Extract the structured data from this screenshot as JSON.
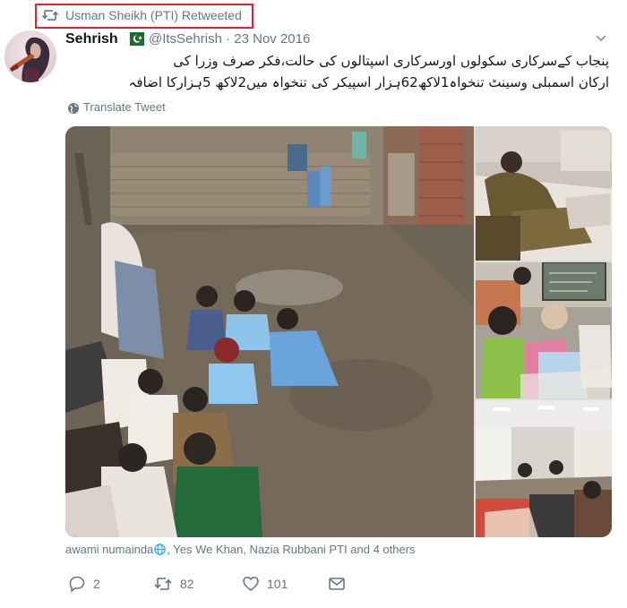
{
  "retweet_header": {
    "text": "Usman Sheikh (PTI) Retweeted",
    "icon": "retweet-icon",
    "highlight_color": "#e0242f"
  },
  "tweet": {
    "author_name": "Sehrish",
    "flag_icon": "pakistan-flag-icon",
    "handle": "@ItsSehrish",
    "date": "23 Nov 2016",
    "separator": "·",
    "body_line_1": "پنجاب کےسرکاری سکولوں اورسرکاری اسپتالوں کی حالت،فکر صرف وزرا کی",
    "body_line_2": "ارکان اسمبلی وسینٹ تنخواہ1لاکھ62ہزار اسپیکر کی تنخواہ میں2لاکھ 5ہزارکا اضافہ",
    "translate_label": "Translate Tweet"
  },
  "likers": {
    "part1": "awami numainda",
    "part2": ", Yes We Khan, Nazia Rubbani PTI and 4 others"
  },
  "actions": {
    "reply_count": "2",
    "retweet_count": "82",
    "like_count": "101"
  },
  "colors": {
    "text_primary": "#14171a",
    "text_secondary": "#657786"
  }
}
